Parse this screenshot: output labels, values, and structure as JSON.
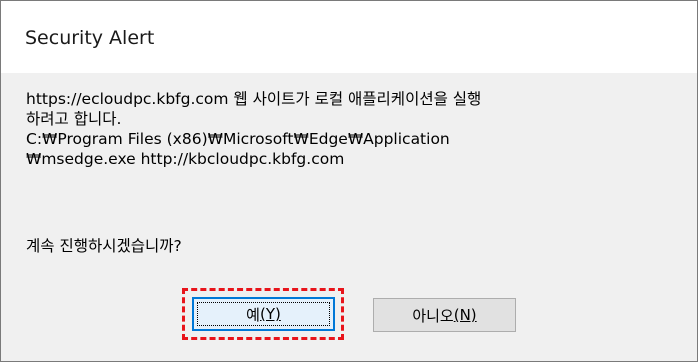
{
  "dialog": {
    "title": "Security Alert",
    "message_lines": [
      "https://ecloudpc.kbfg.com 웹 사이트가 로컬 애플리케이션을 실행",
      "하려고 합니다.",
      "C:₩Program Files (x86)₩Microsoft₩Edge₩Application",
      "₩msedge.exe http://kbcloudpc.kbfg.com"
    ],
    "question": "계속 진행하시겠습니까?",
    "buttons": {
      "yes": {
        "label": "예",
        "mnemonic": "(Y)"
      },
      "no": {
        "label": "아니오",
        "mnemonic": "(N)"
      }
    }
  },
  "colors": {
    "highlight": "#e8141b",
    "focus_border": "#0078d7",
    "dialog_bg": "#f0f0f0"
  }
}
